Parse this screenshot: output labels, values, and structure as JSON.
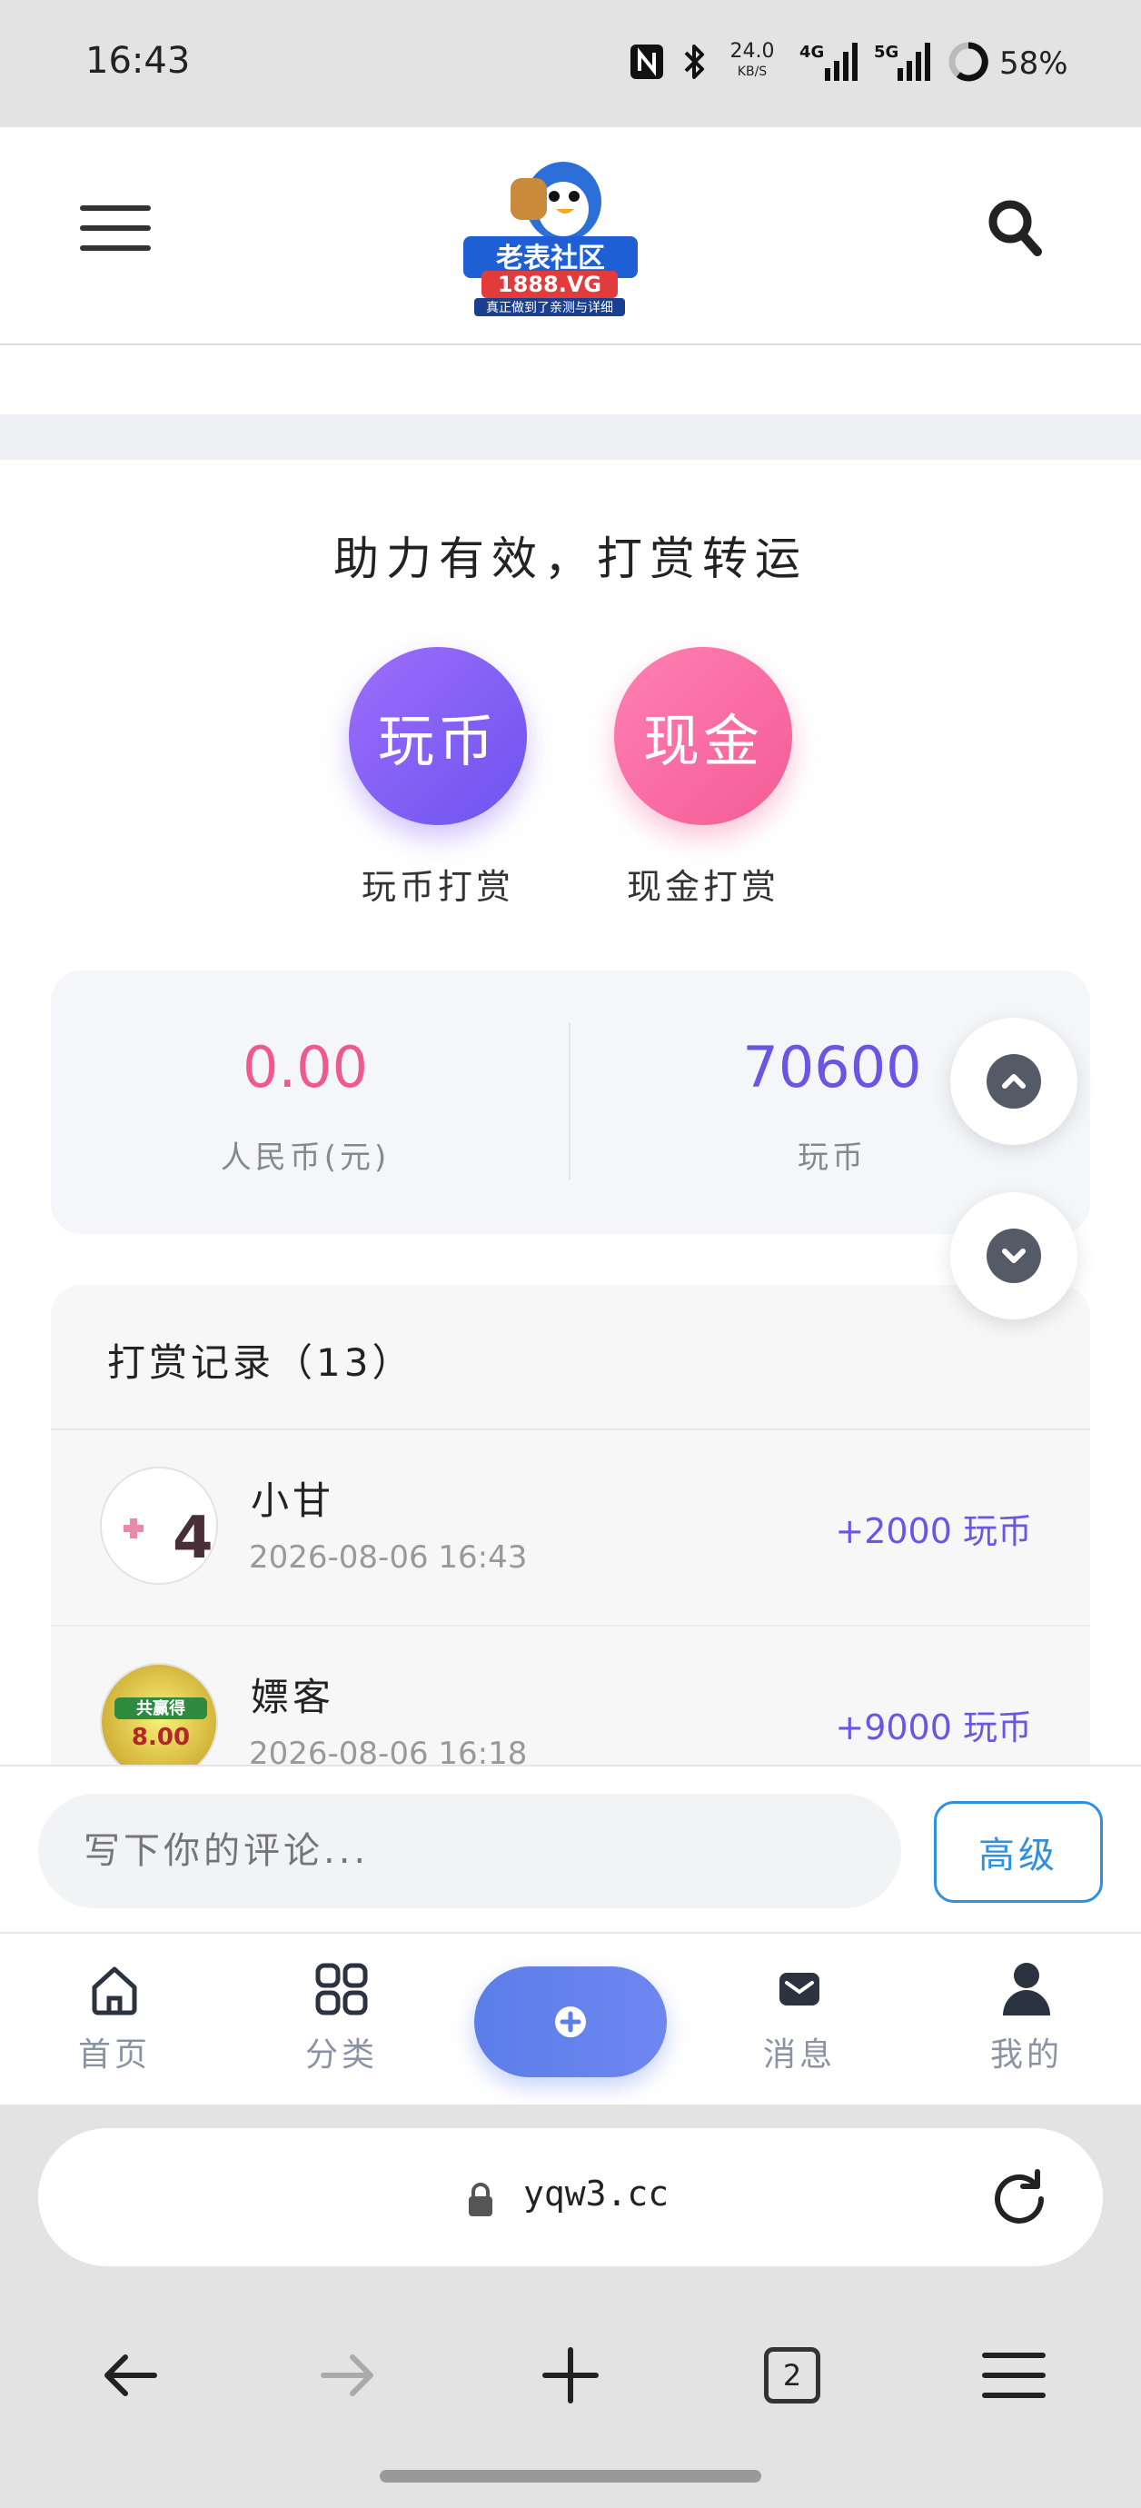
{
  "status_bar": {
    "time": "16:43",
    "speed_value": "24.0",
    "speed_unit": "KB/S",
    "net_4g": "4G",
    "net_5g": "5G",
    "battery": "58%",
    "icons": [
      "nfc-icon",
      "bluetooth-icon",
      "signal-4g-icon",
      "signal-5g-icon",
      "battery-ring-icon"
    ]
  },
  "header": {
    "logo_title": "老表社区",
    "logo_domain": "1888.VG",
    "logo_tagline": "真正做到了亲测与详细"
  },
  "reward": {
    "title": "助力有效，打赏转运",
    "coin_button": "玩币",
    "coin_label": "玩币打赏",
    "cash_button": "现金",
    "cash_label": "现金打赏"
  },
  "balance": {
    "rmb_value": "0.00",
    "rmb_label": "人民币(元)",
    "coin_value": "70600",
    "coin_label": "玩币"
  },
  "records": {
    "title": "打赏记录（13）",
    "items": [
      {
        "name": "小甘",
        "time": "2026-08-06 16:43",
        "amount": "+2000 玩币"
      },
      {
        "name": "嫖客",
        "time": "2026-08-06 16:18",
        "amount": "+9000 玩币",
        "avatar_text": "共赢得 8.00"
      }
    ]
  },
  "comment": {
    "placeholder": "写下你的评论...",
    "advanced_label": "高级"
  },
  "bottom_nav": {
    "home": "首页",
    "category": "分类",
    "messages": "消息",
    "mine": "我的"
  },
  "browser": {
    "url": "yqw3.cc",
    "tab_count": "2"
  },
  "colors": {
    "coin_purple": "#6a55e4",
    "cash_pink": "#f45c93",
    "accent_blue": "#5b7ee8",
    "advanced_blue": "#2f8fe0"
  }
}
